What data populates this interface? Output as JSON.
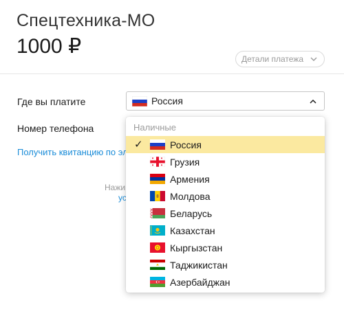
{
  "header": {
    "merchant": "Спецтехника-МО",
    "amount": "1000 ₽",
    "details_button": "Детали платежа"
  },
  "form": {
    "country_label": "Где вы платите",
    "country_value": "Россия",
    "phone_label": "Номер телефона",
    "receipt_link": "Получить квитанцию по эл",
    "footer_text": "Нажи",
    "footer_link": "ус"
  },
  "dropdown": {
    "group_label": "Наличные",
    "options": [
      {
        "label": "Россия",
        "flag": "russia-flag-icon",
        "selected": true
      },
      {
        "label": "Грузия",
        "flag": "georgia-flag-icon",
        "selected": false
      },
      {
        "label": "Армения",
        "flag": "armenia-flag-icon",
        "selected": false
      },
      {
        "label": "Молдова",
        "flag": "moldova-flag-icon",
        "selected": false
      },
      {
        "label": "Беларусь",
        "flag": "belarus-flag-icon",
        "selected": false
      },
      {
        "label": "Казахстан",
        "flag": "kazakhstan-flag-icon",
        "selected": false
      },
      {
        "label": "Кыргызстан",
        "flag": "kyrgyzstan-flag-icon",
        "selected": false
      },
      {
        "label": "Таджикистан",
        "flag": "tajikistan-flag-icon",
        "selected": false
      },
      {
        "label": "Азербайджан",
        "flag": "azerbaijan-flag-icon",
        "selected": false
      }
    ],
    "checkmark": "✓"
  },
  "colors": {
    "selected_highlight": "#fbe9a0",
    "link": "#1a8cd8"
  }
}
